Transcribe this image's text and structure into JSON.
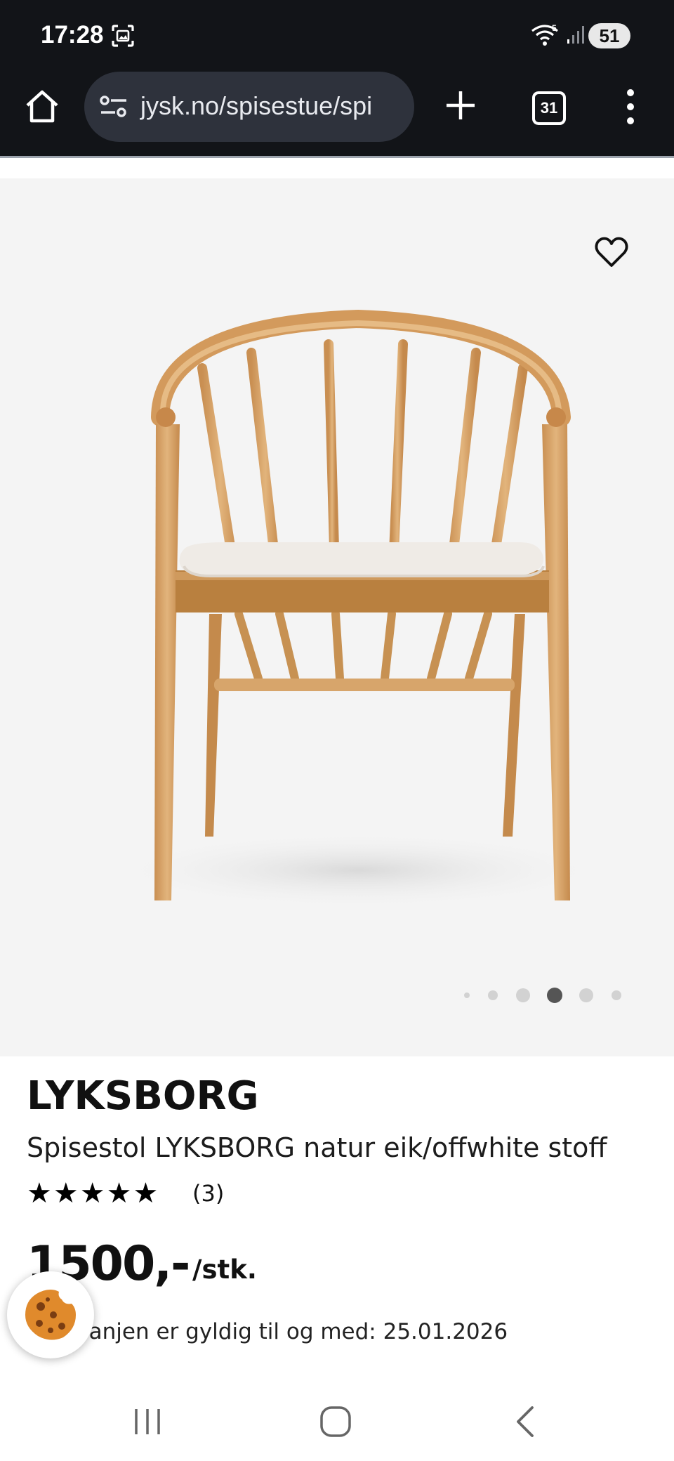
{
  "status_bar": {
    "time": "17:28",
    "battery": "51"
  },
  "browser": {
    "url": "jysk.no/spisestue/spi",
    "tab_count": "31"
  },
  "product": {
    "brand": "LYKSBORG",
    "name": "Spisestol LYKSBORG natur eik/offwhite stoff",
    "rating_stars": "★★★★★",
    "rating_value": 5,
    "review_count": "(3)",
    "price": "1500,-",
    "unit": "/stk.",
    "campaign_text": "Kampanjen er gyldig til og med: 25.01.2026"
  },
  "carousel": {
    "total_images": 6,
    "active_index": 3
  },
  "colors": {
    "system_bar": "#121418",
    "url_pill": "#2e323c",
    "image_bg": "#f4f4f4",
    "oak": "#d9a66b",
    "seat_fabric": "#efebe6",
    "cookie": "#e08a2c"
  }
}
